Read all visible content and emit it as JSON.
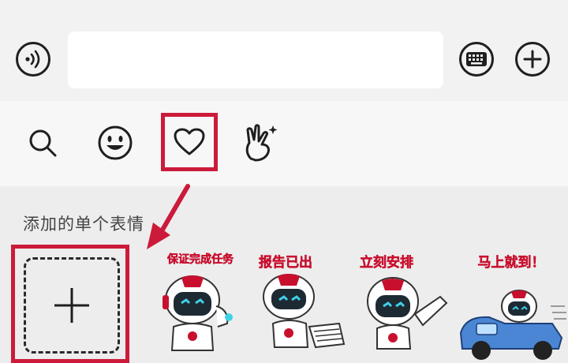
{
  "input_bar": {
    "voice_icon": "voice-wave-icon",
    "text_value": "",
    "keyboard_icon": "keyboard-icon",
    "plus_icon": "plus-circle-icon"
  },
  "tabs": [
    {
      "id": "search",
      "icon": "search-icon"
    },
    {
      "id": "emoji",
      "icon": "smile-icon"
    },
    {
      "id": "favorites",
      "icon": "heart-icon",
      "selected": true
    },
    {
      "id": "stickers",
      "icon": "hand-sparkle-icon"
    }
  ],
  "section": {
    "title": "添加的单个表情"
  },
  "add_tile": {
    "icon": "plus-icon"
  },
  "stickers": [
    {
      "caption": "保证完成任务"
    },
    {
      "caption": "报告已出"
    },
    {
      "caption": "立刻安排"
    },
    {
      "caption": "马上就到！"
    }
  ],
  "colors": {
    "highlight": "#cc1b3a",
    "icon": "#1f1f1f",
    "sticker_red": "#c8102e"
  }
}
